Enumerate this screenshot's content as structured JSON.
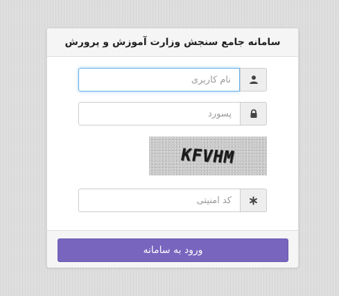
{
  "header": {
    "title": "سامانه جامع سنجش وزارت آموزش و پرورش"
  },
  "form": {
    "username": {
      "value": "",
      "placeholder": "نام کاربری",
      "icon": "user-icon"
    },
    "password": {
      "value": "",
      "placeholder": "پسورد",
      "icon": "lock-icon"
    },
    "captcha": {
      "text": "KFVHM"
    },
    "security_code": {
      "value": "",
      "placeholder": "کد امنیتی",
      "icon": "asterisk-icon"
    }
  },
  "footer": {
    "submit_label": "ورود به سامانه"
  },
  "colors": {
    "accent": "#7765be",
    "focus_border": "#66afe9",
    "addon_bg": "#eeeeee"
  }
}
